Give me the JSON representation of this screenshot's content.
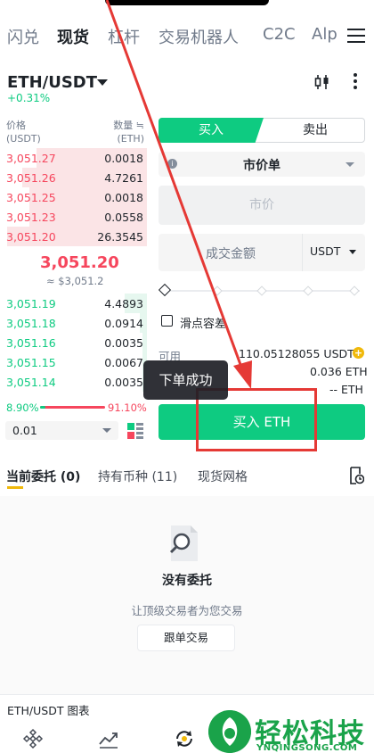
{
  "top_nav": {
    "tabs": [
      {
        "label": "闪兑",
        "active": false
      },
      {
        "label": "现货",
        "active": true
      },
      {
        "label": "杠杆",
        "active": false
      },
      {
        "label": "交易机器人",
        "active": false
      },
      {
        "label": "C2C",
        "active": false
      },
      {
        "label": "Alp",
        "active": false
      }
    ],
    "menu_icon": "hamburger-icon"
  },
  "header": {
    "pair": "ETH/USDT",
    "change": "+0.31%",
    "icons": [
      "candlestick-chart-icon",
      "more-vertical-icon"
    ]
  },
  "orderbook": {
    "price_label": "价格",
    "price_unit": "(USDT)",
    "qty_label": "数量 ≒",
    "qty_unit": "(ETH)",
    "asks": [
      {
        "price": "3,051.27",
        "qty": "0.0018",
        "depth": 0.75
      },
      {
        "price": "3,051.26",
        "qty": "4.7261",
        "depth": 0.85
      },
      {
        "price": "3,051.25",
        "qty": "0.0018",
        "depth": 0.8
      },
      {
        "price": "3,051.23",
        "qty": "0.0558",
        "depth": 0.8
      },
      {
        "price": "3,051.20",
        "qty": "26.3545",
        "depth": 0.95
      }
    ],
    "last_price": "3,051.20",
    "last_price_usd": "≈ $3,051.2",
    "bids": [
      {
        "price": "3,051.19",
        "qty": "4.4893",
        "depth": 0.15
      },
      {
        "price": "3,051.18",
        "qty": "0.0914",
        "depth": 0.05
      },
      {
        "price": "3,051.16",
        "qty": "0.0035",
        "depth": 0.03
      },
      {
        "price": "3,051.15",
        "qty": "0.0067",
        "depth": 0.03
      },
      {
        "price": "3,051.14",
        "qty": "0.0035",
        "depth": 0.03
      }
    ],
    "bid_ratio": "8.90%",
    "ask_ratio": "91.10%",
    "bid_ratio_value": 0.089,
    "depth_value": "0.01"
  },
  "order_form": {
    "buy_tab": "买入",
    "sell_tab": "卖出",
    "order_type": "市价单",
    "price_placeholder": "市价",
    "amount_placeholder": "成交金额",
    "amount_unit": "USDT",
    "slippage_label": "滑点容差",
    "available_label": "可用",
    "available_value": "110.05128055 USDT",
    "max_buy": "0.036 ETH",
    "fee": "-- ETH",
    "submit_label": "买入 ETH"
  },
  "toast": "下单成功",
  "bottom_tabs": {
    "tabs": [
      {
        "label": "当前委托 (0)",
        "active": true
      },
      {
        "label": "持有币种 (11)",
        "active": false
      },
      {
        "label": "现货网格",
        "active": false
      }
    ]
  },
  "empty_state": {
    "title": "没有委托",
    "subtitle": "让顶级交易者为您交易",
    "button": "跟单交易"
  },
  "chart_link": "ETH/USDT 图表",
  "watermark": {
    "text": "轻松科技",
    "url": "YNQINGSONG.COM"
  },
  "colors": {
    "buy": "#0ecb81",
    "sell": "#f6465d",
    "accent": "#f0b90b",
    "annotation": "#e53935"
  }
}
